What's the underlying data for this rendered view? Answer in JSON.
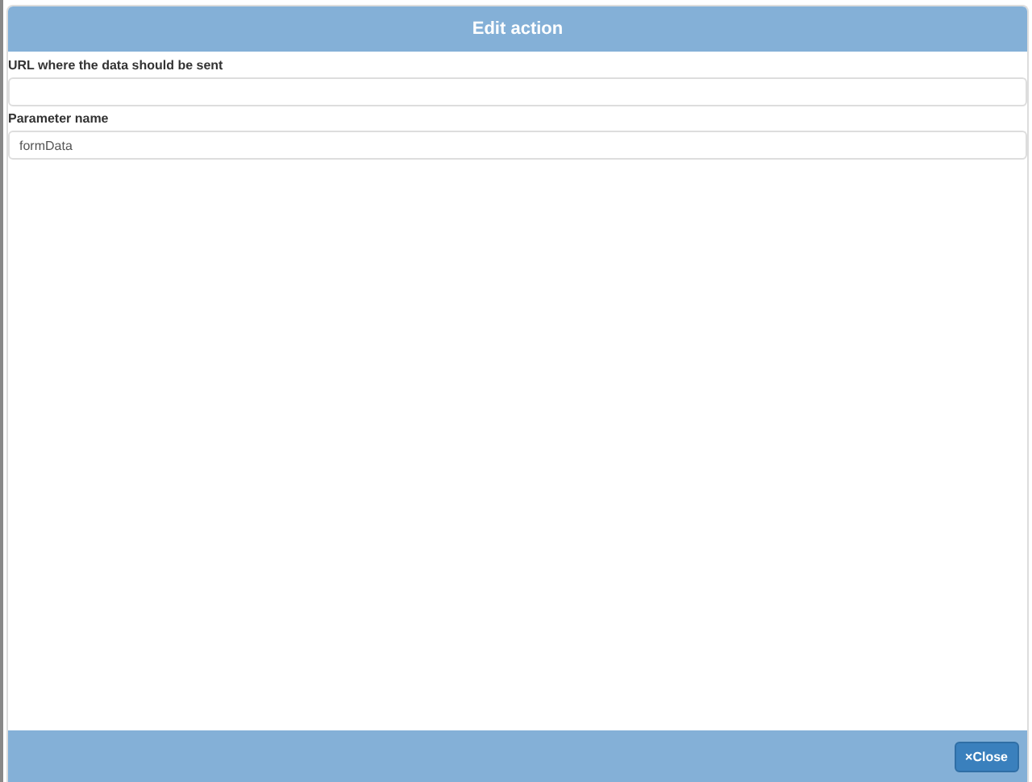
{
  "dialog": {
    "title": "Edit action",
    "fields": [
      {
        "label": "URL where the data should be sent"
      },
      {
        "label": "Parameter name",
        "value": "formData"
      }
    ],
    "buttons": [
      {
        "icon": "×",
        "label": "Close"
      }
    ]
  }
}
